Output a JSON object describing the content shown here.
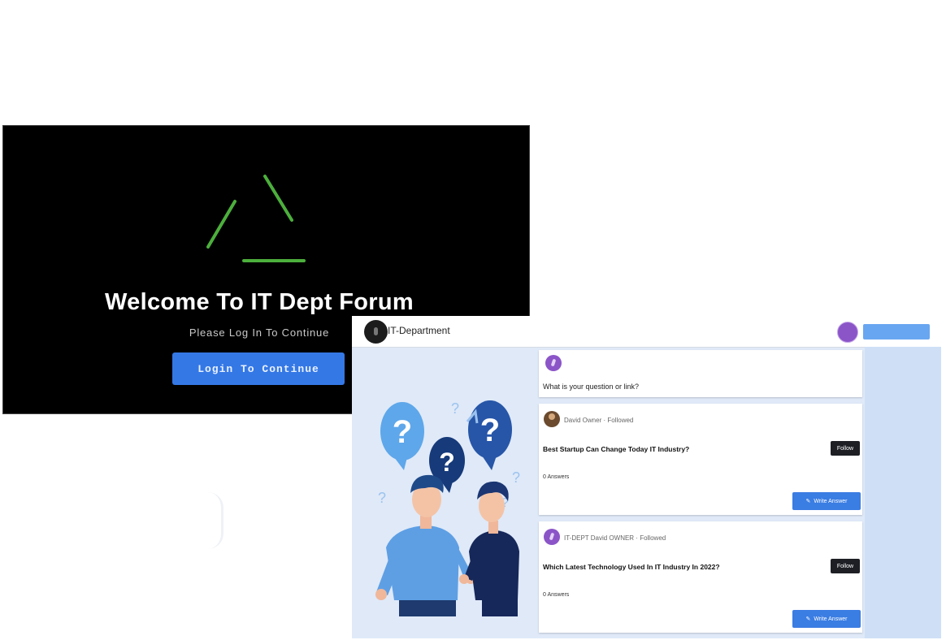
{
  "login": {
    "title": "Welcome To IT Dept Forum",
    "subtitle": "Please Log In To Continue",
    "button_label": "Login To Continue",
    "logo_icon": "triangle-logo-icon",
    "logo_color": "#4caf3c",
    "button_color": "#3478e6"
  },
  "forum": {
    "brand": "IT-Department",
    "ask_placeholder": "What is your question or link?",
    "posts": [
      {
        "meta": "David Owner · Followed",
        "question": "Best Startup Can Change Today IT Industry?",
        "follow_label": "Follow",
        "answers_label": "0 Answers",
        "answer_button": "Write Answer"
      },
      {
        "meta": "IT-DEPT David OWNER · Followed",
        "question": "Which Latest Technology Used In IT Industry In 2022?",
        "follow_label": "Follow",
        "answers_label": "0 Answers",
        "answer_button": "Write Answer"
      }
    ],
    "accent_color": "#3a7de3",
    "avatar_color": "#8b55c8"
  }
}
